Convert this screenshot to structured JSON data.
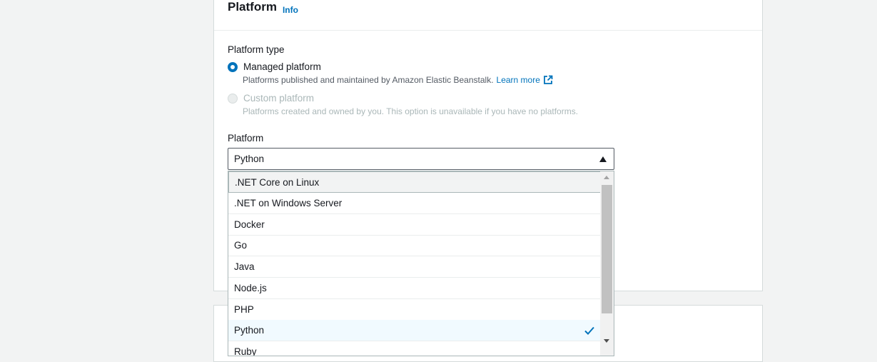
{
  "panel": {
    "title": "Platform",
    "info_link": "Info"
  },
  "platform_type": {
    "label": "Platform type",
    "managed": {
      "label": "Managed platform",
      "description": "Platforms published and maintained by Amazon Elastic Beanstalk.",
      "learn_more": "Learn more",
      "selected": true
    },
    "custom": {
      "label": "Custom platform",
      "description": "Platforms created and owned by you. This option is unavailable if you have no platforms.",
      "disabled": true
    }
  },
  "platform": {
    "label": "Platform",
    "selected_value": "Python",
    "options": [
      ".NET Core on Linux",
      ".NET on Windows Server",
      "Docker",
      "Go",
      "Java",
      "Node.js",
      "PHP",
      "Python",
      "Ruby"
    ]
  },
  "icons": {
    "external": "external-link-icon",
    "check": "check-icon",
    "caret": "caret-up-icon"
  },
  "colors": {
    "accent": "#0073bb",
    "selected_bg": "#f1faff",
    "page_bg": "#f2f3f3"
  }
}
